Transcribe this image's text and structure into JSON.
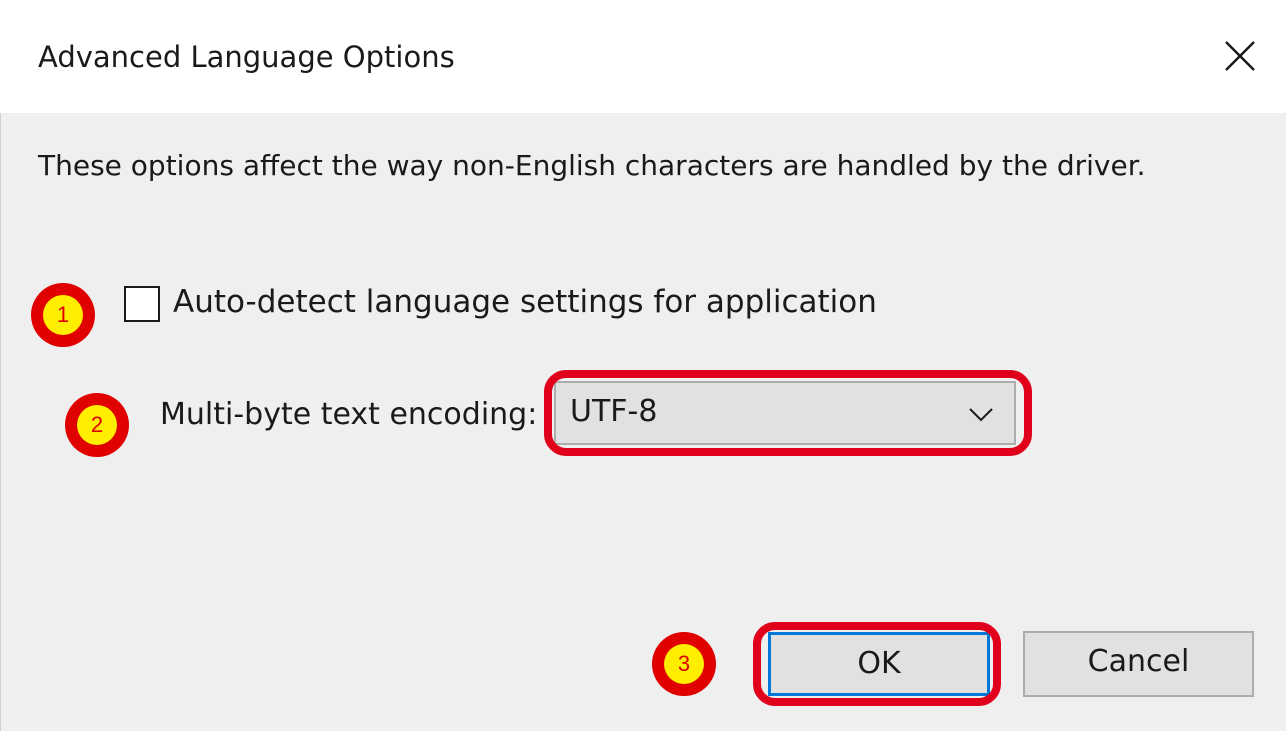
{
  "dialog": {
    "title": "Advanced Language Options",
    "close_icon": "close-icon",
    "description": "These options affect the way non-English characters are handled by the driver."
  },
  "auto_detect": {
    "label": "Auto-detect language settings for application",
    "checked": false
  },
  "encoding": {
    "label": "Multi-byte text encoding:",
    "selected": "UTF-8",
    "arrow_icon": "chevron-down-icon"
  },
  "buttons": {
    "ok_label": "OK",
    "cancel_label": "Cancel"
  },
  "annotations": {
    "step1": "1",
    "step2": "2",
    "step3": "3",
    "badge_outer_color": "#e00000",
    "badge_inner_color": "#ffee00",
    "highlight_color": "#e0001b"
  }
}
